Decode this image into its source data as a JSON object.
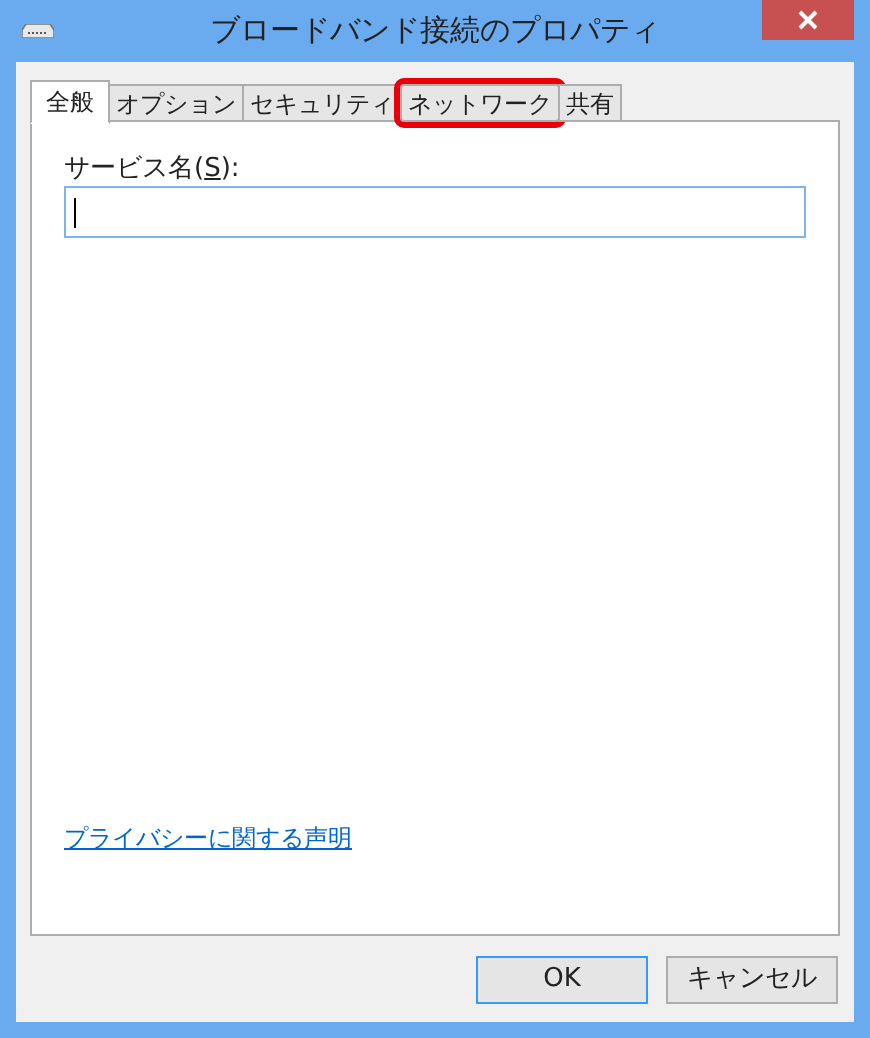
{
  "window": {
    "title": "ブロードバンド接続のプロパティ"
  },
  "tabs": [
    {
      "label": "全般",
      "selected": true,
      "highlighted": false
    },
    {
      "label": "オプション",
      "selected": false,
      "highlighted": false
    },
    {
      "label": "セキュリティ",
      "selected": false,
      "highlighted": false
    },
    {
      "label": "ネットワーク",
      "selected": false,
      "highlighted": true
    },
    {
      "label": "共有",
      "selected": false,
      "highlighted": false
    }
  ],
  "service_name": {
    "label_before": "サービス名(",
    "access_key": "S",
    "label_after": "):"
  },
  "privacy_link": "プライバシーに関する声明",
  "buttons": [
    {
      "label": "OK",
      "default": true
    },
    {
      "label": "キャンセル",
      "default": false
    }
  ]
}
